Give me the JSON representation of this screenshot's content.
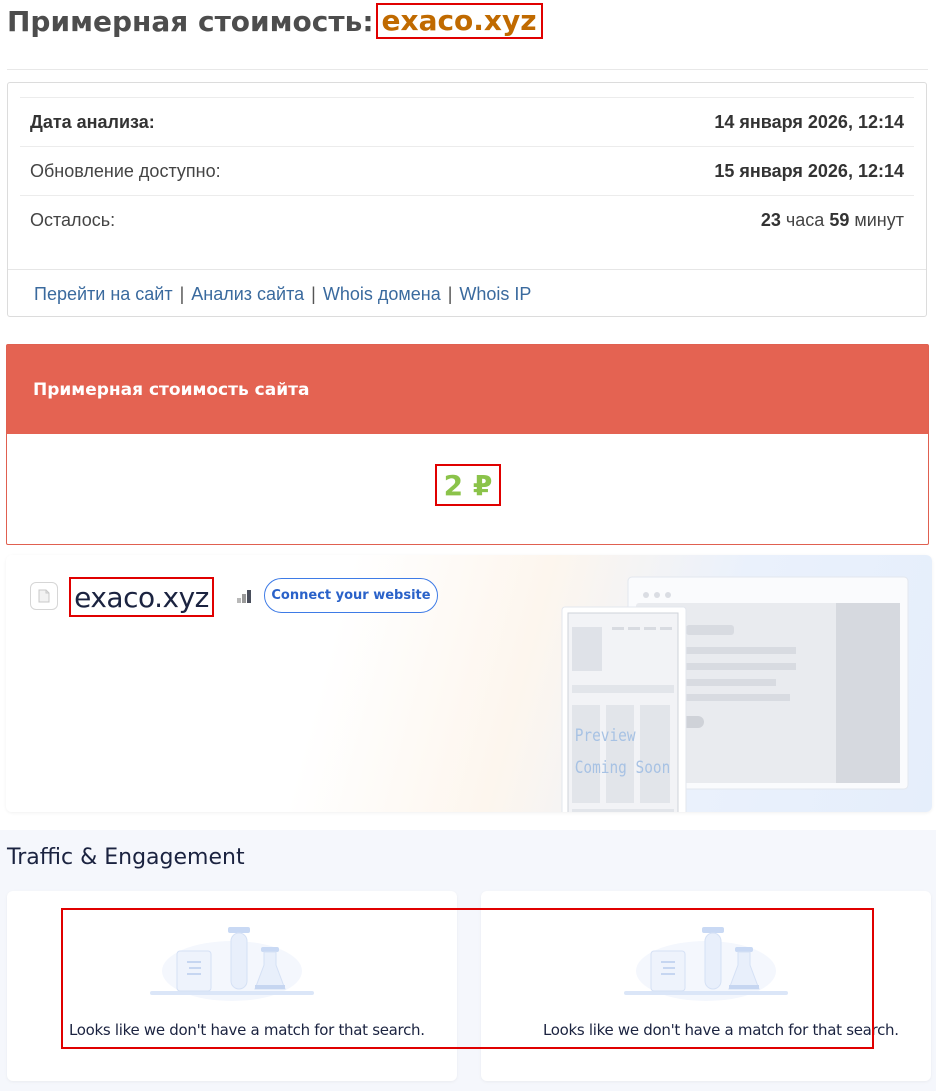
{
  "title": {
    "prefix": "Примерная стоимость:",
    "domain": "exaco.xyz"
  },
  "info": {
    "rows": [
      {
        "label": "Дата анализа:",
        "value": "14 января 2026, 12:14"
      },
      {
        "label": "Обновление доступно:",
        "value": "15 января 2026, 12:14"
      },
      {
        "label": "Осталось:",
        "hours": "23",
        "hours_unit": "часа",
        "minutes": "59",
        "minutes_unit": "минут"
      }
    ],
    "links": [
      "Перейти на сайт",
      "Анализ сайта",
      "Whois домена",
      "Whois IP"
    ],
    "separator": "|"
  },
  "cost": {
    "heading": "Примерная стоимость сайта",
    "value": "2 ₽"
  },
  "hero": {
    "domain": "exaco.xyz",
    "connect_label": "Connect your website",
    "preview_line1": "Preview",
    "preview_line2": "Coming Soon"
  },
  "traffic": {
    "title": "Traffic & Engagement",
    "empty_left": "Looks like we don't have a match for that search.",
    "empty_right": "Looks like we don't have a match for that search."
  },
  "colors": {
    "accent_red": "#e46352",
    "value_green": "#8bc34a",
    "link_blue": "#3a6a9e",
    "domain_orange": "#c06a00"
  }
}
